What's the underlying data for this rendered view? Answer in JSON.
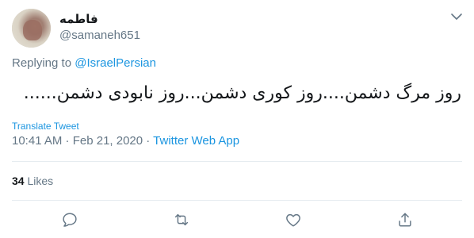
{
  "tweet": {
    "display_name": "فاطمه",
    "handle": "@samaneh651",
    "reply_prefix": "Replying to ",
    "reply_to": "@IsraelPersian",
    "text": "روز مرگ دشمن....روز کوری دشمن...روز نابودی دشمن......",
    "translate_label": "Translate Tweet",
    "timestamp": "10:41 AM · Feb 21, 2020 · ",
    "source": "Twitter Web App",
    "likes_count": "34",
    "likes_label": " Likes"
  },
  "colors": {
    "link": "#1b95e0",
    "secondary": "#657786",
    "text": "#14171a",
    "divider": "#e6ecf0"
  },
  "icons": {
    "caret": "chevron-down-icon",
    "reply": "reply-icon",
    "retweet": "retweet-icon",
    "like": "heart-icon",
    "share": "share-icon"
  }
}
